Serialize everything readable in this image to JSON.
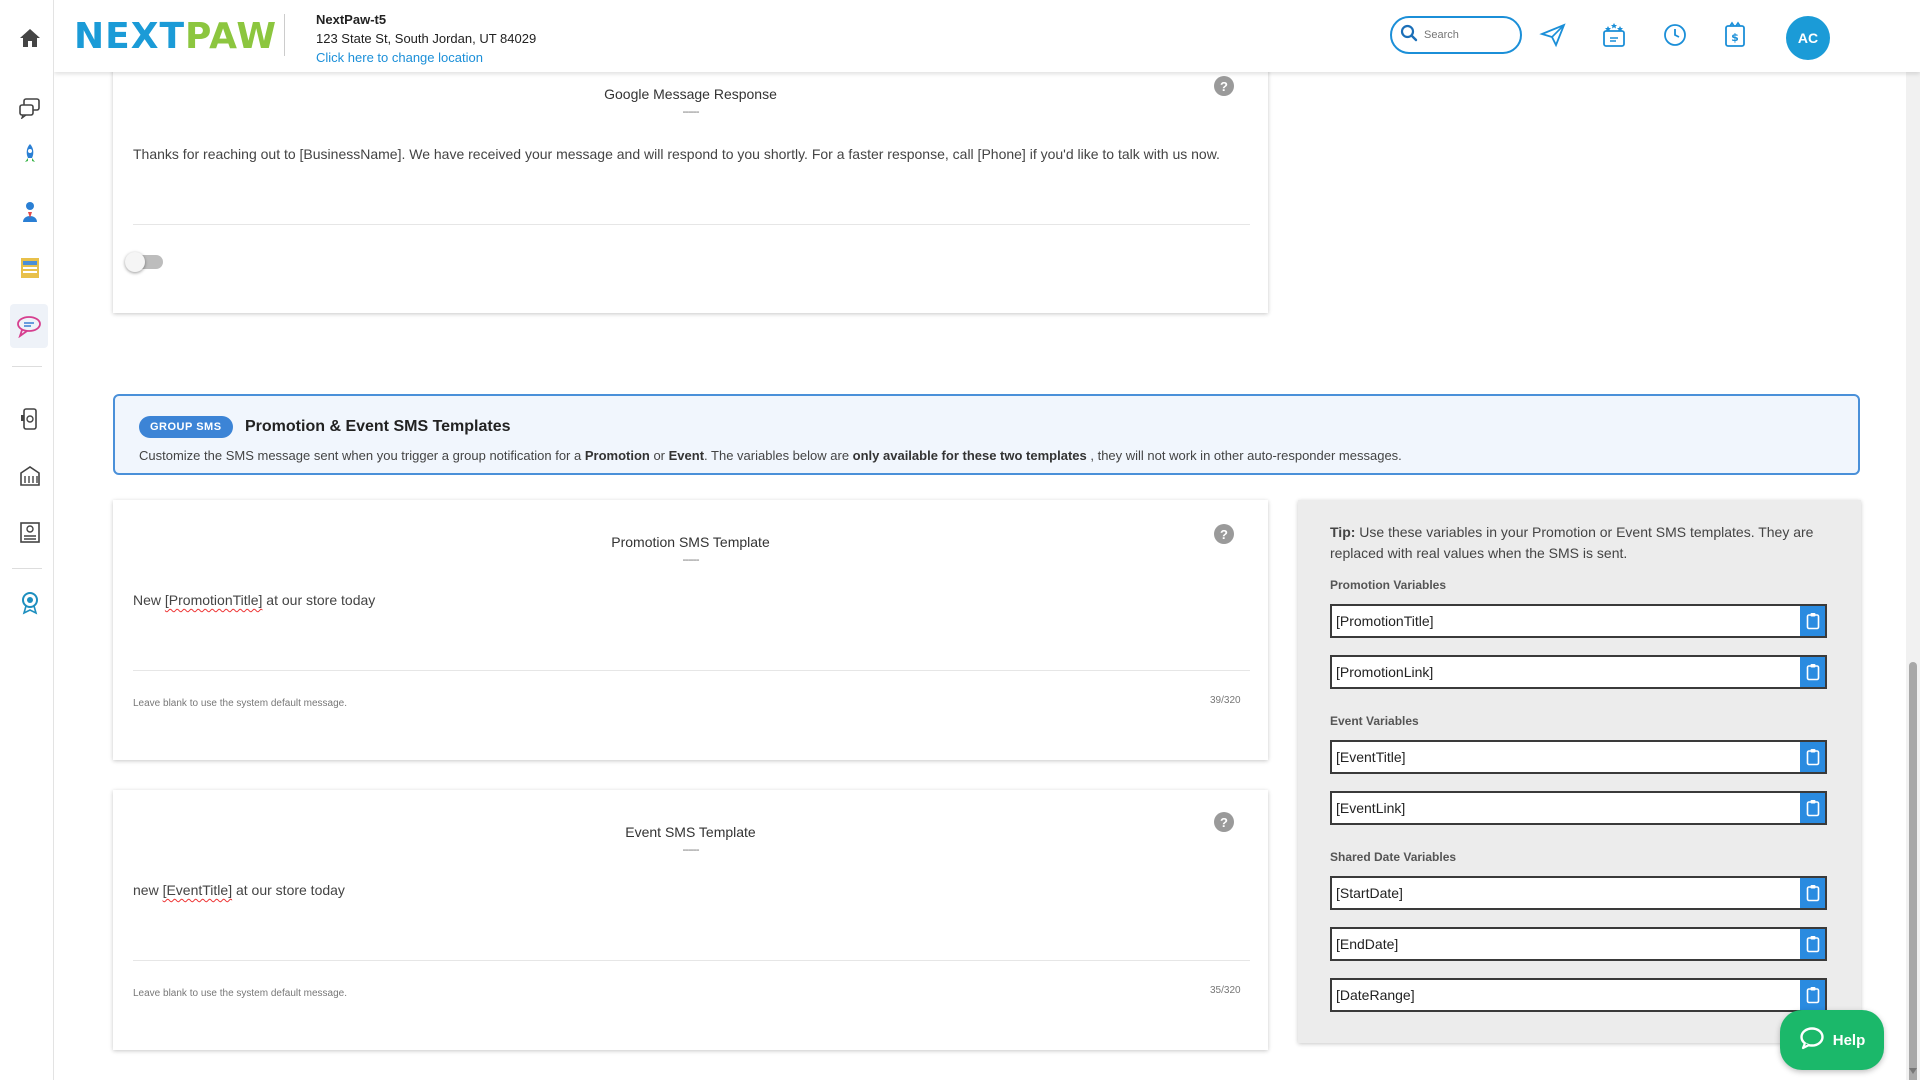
{
  "rail": {
    "items": [
      "home-icon",
      "chat-icon",
      "rocket-icon",
      "person-icon",
      "layout-icon",
      "message-bubbles-icon",
      "phone-icon",
      "building-icon",
      "bank-icon",
      "award-icon"
    ]
  },
  "header": {
    "logo_part1": "NEXT",
    "logo_part2": "PAW",
    "location_name": "NextPaw-t5",
    "location_address": "123 State St, South Jordan, UT 84029",
    "change_location": "Click here to change location",
    "search_placeholder": "Search",
    "avatar_initials": "AC"
  },
  "google_card": {
    "title": "Google Message Response",
    "dashes": "------",
    "help": "?",
    "message": "Thanks for reaching out to [BusinessName]. We have received your message and will respond to you shortly. For a faster response, call [Phone] if you'd like to talk with us now.",
    "toggle_on": false
  },
  "banner": {
    "badge": "GROUP SMS",
    "title": "Promotion & Event SMS Templates",
    "desc_1": "Customize the SMS message sent when you trigger a group notification for a ",
    "desc_promo": "Promotion",
    "desc_or": " or ",
    "desc_event": "Event",
    "desc_2": ". The variables below are ",
    "desc_bold": "only available for these two templates",
    "desc_3": " , they will not work in other auto-responder messages."
  },
  "promotion_card": {
    "title": "Promotion SMS Template",
    "dashes": "------",
    "help": "?",
    "text_before": "New ",
    "text_var": "[PromotionTitle]",
    "text_after": " at our store today",
    "hint": "Leave blank to use the system default message.",
    "counter": "39/320"
  },
  "event_card": {
    "title": "Event SMS Template",
    "dashes": "------",
    "help": "?",
    "text_before": "new ",
    "text_var": "[EventTitle]",
    "text_after": " at our store today",
    "hint": "Leave blank to use the system default message.",
    "counter": "35/320"
  },
  "tips": {
    "tip_label": "Tip:",
    "tip_text": " Use these variables in your Promotion or Event SMS templates. They are replaced with real values when the SMS is sent.",
    "promotion_label": "Promotion Variables",
    "promotion_vars": [
      "[PromotionTitle]",
      "[PromotionLink]"
    ],
    "event_label": "Event Variables",
    "event_vars": [
      "[EventTitle]",
      "[EventLink]"
    ],
    "date_label": "Shared Date Variables",
    "date_vars": [
      "[StartDate]",
      "[EndDate]",
      "[DateRange]"
    ]
  },
  "help_button": {
    "label": "Help"
  },
  "colors": {
    "brand_blue": "#1b9bd7",
    "brand_green": "#8cc63f",
    "help_green": "#1bb86a",
    "banner_border": "#4a90d9"
  }
}
